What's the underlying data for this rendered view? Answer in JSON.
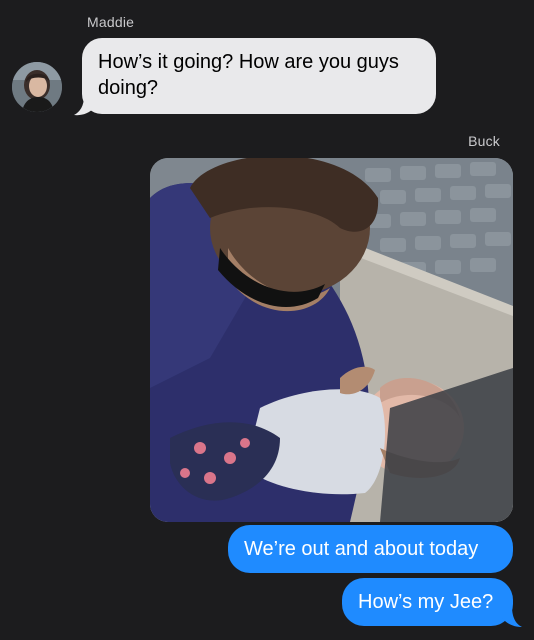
{
  "conversation": {
    "messages": [
      {
        "sender": "Maddie",
        "text": "How’s it going? How are you guys doing?",
        "direction": "incoming"
      },
      {
        "sender": "Buck",
        "type": "photo",
        "direction": "outgoing"
      },
      {
        "sender": "Buck",
        "text": "We’re out and about today",
        "direction": "outgoing"
      },
      {
        "sender": "Buck",
        "text": "How’s my Jee?",
        "direction": "outgoing"
      }
    ]
  },
  "colors": {
    "background": "#1c1c1e",
    "incoming_bubble": "#e9e9eb",
    "outgoing_bubble": "#1f8bff",
    "sender_name": "#c9c9cc"
  },
  "icons": {
    "avatar": "avatar-maddie",
    "photo": "photo-attachment"
  }
}
